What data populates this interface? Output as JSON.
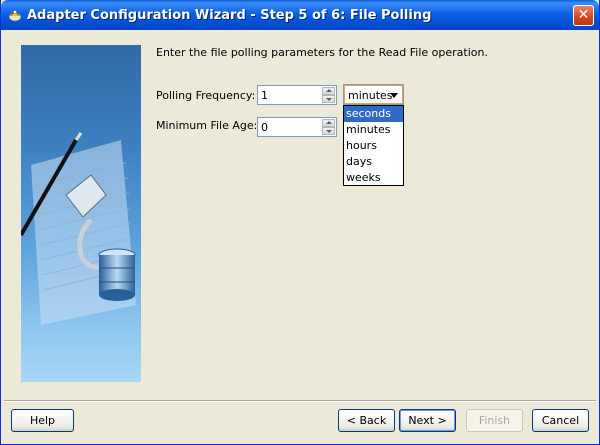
{
  "window": {
    "title": "Adapter Configuration Wizard - Step 5 of 6: File Polling",
    "close_glyph": "✕"
  },
  "intro_text": "Enter the file polling parameters for the Read File operation.",
  "polling_frequency": {
    "label": "Polling Frequency:",
    "value": "1",
    "unit_value": "minutes",
    "unit_options": [
      "seconds",
      "minutes",
      "hours",
      "days",
      "weeks"
    ],
    "highlighted_option": "seconds"
  },
  "minimum_file_age": {
    "label": "Minimum File Age:",
    "value": "0"
  },
  "buttons": {
    "help": "Help",
    "back": "< Back",
    "next": "Next >",
    "finish": "Finish",
    "cancel": "Cancel"
  },
  "colors": {
    "titlebar": "#0553d6",
    "selection": "#316ac5",
    "dialog_bg": "#ece9d8"
  }
}
